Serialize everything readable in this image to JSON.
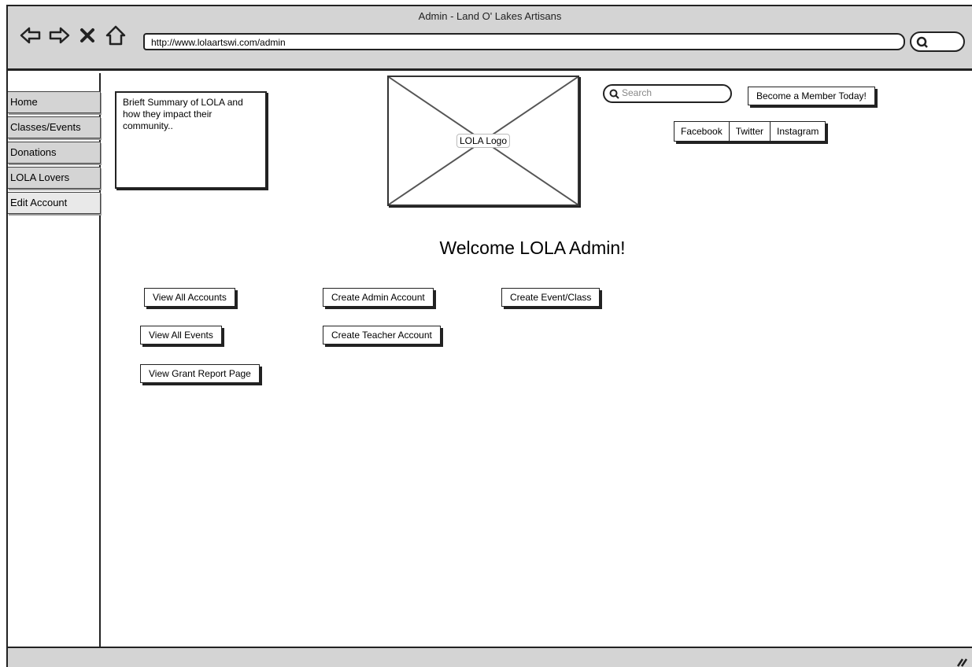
{
  "window": {
    "title": "Admin - Land O' Lakes Artisans",
    "url": "http://www.lolaartswi.com/admin"
  },
  "sidebar": {
    "items": [
      {
        "label": "Home"
      },
      {
        "label": "Classes/Events"
      },
      {
        "label": "Donations"
      },
      {
        "label": "LOLA Lovers"
      },
      {
        "label": "Edit Account"
      }
    ]
  },
  "header": {
    "summary": "Brieft Summary of LOLA and how they impact their community..",
    "logo_label": "LOLA Logo",
    "search_placeholder": "Search",
    "member_button": "Become a Member Today!",
    "social": [
      "Facebook",
      "Twitter",
      "Instagram"
    ]
  },
  "main": {
    "welcome": "Welcome LOLA Admin!",
    "actions": {
      "view_all_accounts": "View All Accounts",
      "create_admin_account": "Create Admin Account",
      "create_event_class": "Create Event/Class",
      "view_all_events": "View All Events",
      "create_teacher_account": "Create Teacher Account",
      "view_grant_report": "View Grant Report Page"
    }
  },
  "icons": {
    "back": "arrow-left-icon",
    "forward": "arrow-right-icon",
    "stop": "close-icon",
    "home": "home-icon",
    "search": "search-icon"
  }
}
